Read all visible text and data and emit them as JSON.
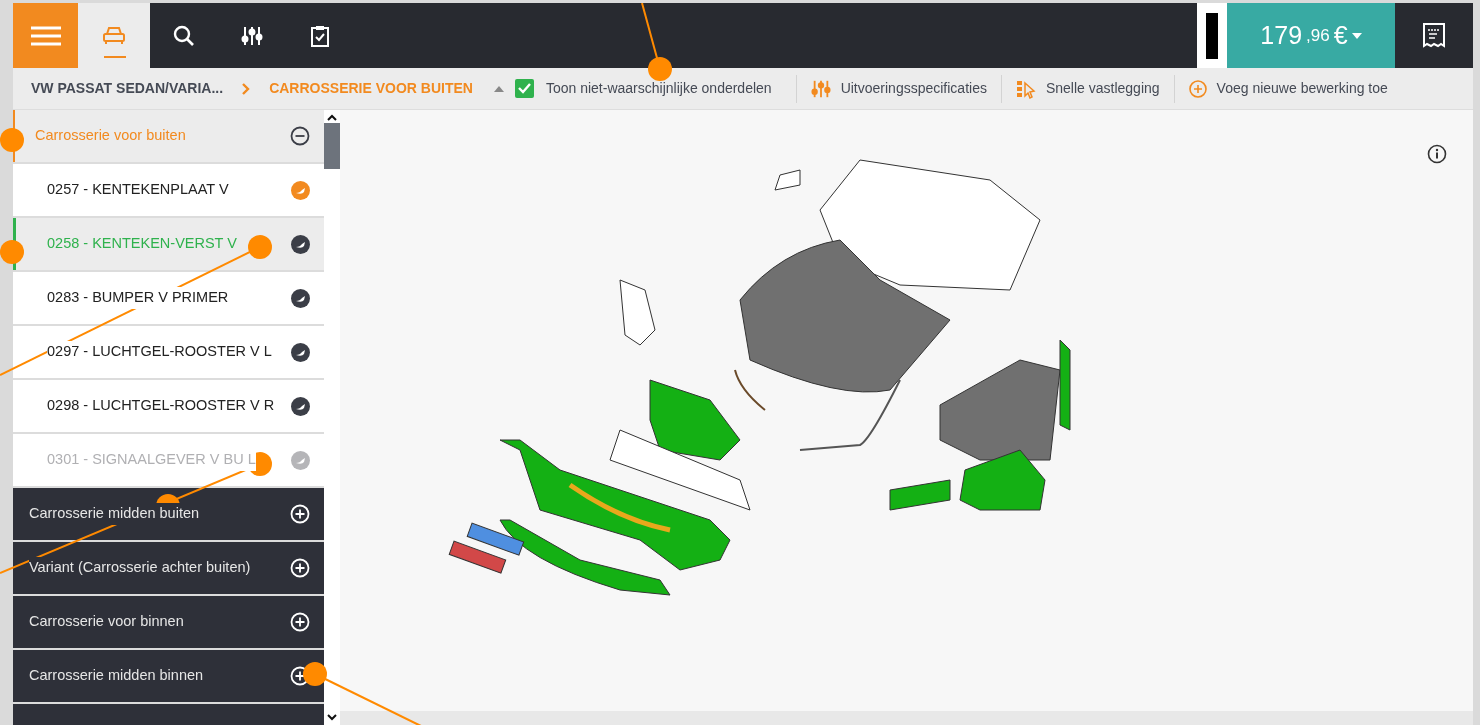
{
  "toolbar": {
    "tabs": [
      {
        "kind": "car",
        "selected": true
      },
      {
        "kind": "search",
        "selected": false
      },
      {
        "kind": "sliders",
        "selected": false
      },
      {
        "kind": "checklist",
        "selected": false
      }
    ],
    "price": {
      "whole": "179",
      "fraction": ",96",
      "currency": "€"
    }
  },
  "breadcrumb": {
    "vehicle": "VW PASSAT SEDAN/VARIA...",
    "section": "CARROSSERIE VOOR BUITEN",
    "show_unlikely": {
      "label": "Toon niet-waarschijnlijke onderdelen",
      "checked": true
    },
    "actions": [
      {
        "kind": "sliders",
        "label": "Uitvoeringsspecificaties"
      },
      {
        "kind": "select",
        "label": "Snelle vastlegging"
      },
      {
        "kind": "add",
        "label": "Voeg nieuwe bewerking toe"
      }
    ]
  },
  "sidebar": {
    "groups": [
      {
        "label": "Carrosserie voor buiten",
        "expanded": true,
        "children": [
          {
            "label": "0257 - KENTEKENPLAAT V",
            "selected": false,
            "disabled": false,
            "color": "#f28a1f"
          },
          {
            "label": "0258 - KENTEKEN-VERST V",
            "selected": true,
            "disabled": false,
            "color": "#3b3e47"
          },
          {
            "label": "0283 - BUMPER V PRIMER",
            "selected": false,
            "disabled": false,
            "color": "#3b3e47"
          },
          {
            "label": "0297 - LUCHTGEL-ROOSTER V L",
            "selected": false,
            "disabled": false,
            "color": "#3b3e47"
          },
          {
            "label": "0298 - LUCHTGEL-ROOSTER V R",
            "selected": false,
            "disabled": false,
            "color": "#3b3e47"
          },
          {
            "label": "0301 - SIGNAALGEVER V BU L",
            "selected": false,
            "disabled": true,
            "color": "#b5b5b8"
          }
        ]
      },
      {
        "label": "Carrosserie midden buiten",
        "expanded": false
      },
      {
        "label": "Variant (Carrosserie achter buiten)",
        "expanded": false
      },
      {
        "label": "Carrosserie voor binnen",
        "expanded": false
      },
      {
        "label": "Carrosserie midden binnen",
        "expanded": false
      }
    ]
  }
}
